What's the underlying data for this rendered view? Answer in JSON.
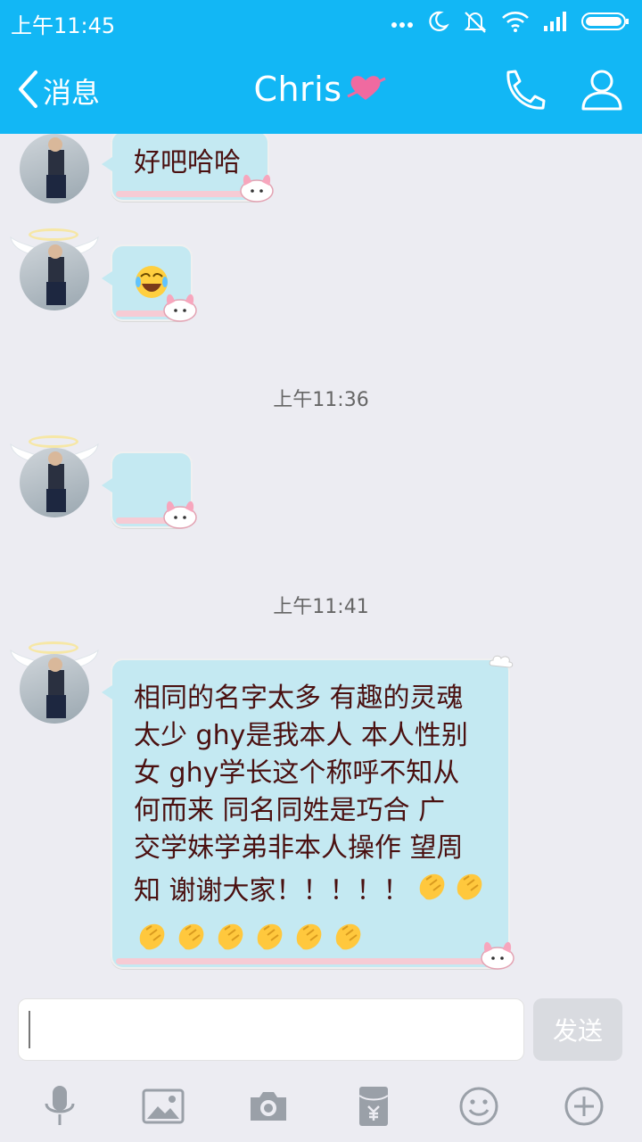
{
  "status_bar": {
    "time": "上午11:45"
  },
  "header": {
    "back_label": "消息",
    "title": "Chris",
    "accent_color": "#12b7f5"
  },
  "messages": [
    {
      "type": "text",
      "text": "好吧哈哈"
    },
    {
      "type": "emoji",
      "icon": "laughing-crying-emoji"
    },
    {
      "type": "timestamp",
      "text": "上午11:36"
    },
    {
      "type": "empty-bubble"
    },
    {
      "type": "timestamp",
      "text": "上午11:41"
    },
    {
      "type": "text",
      "lines": [
        "相同的名字太多 有趣的灵魂",
        "太少 ghy是我本人 本人性别",
        "女  ghy学长这个称呼不知从",
        "何而来 同名同姓是巧合 广",
        "交学妹学弟非本人操作 望周",
        "知 谢谢大家！！！！！"
      ],
      "trailing_emojis": 8
    }
  ],
  "input": {
    "send_label": "发送"
  },
  "toolbar": {
    "items": [
      "microphone-icon",
      "image-icon",
      "camera-icon",
      "red-packet-icon",
      "emoji-icon",
      "plus-icon"
    ]
  }
}
